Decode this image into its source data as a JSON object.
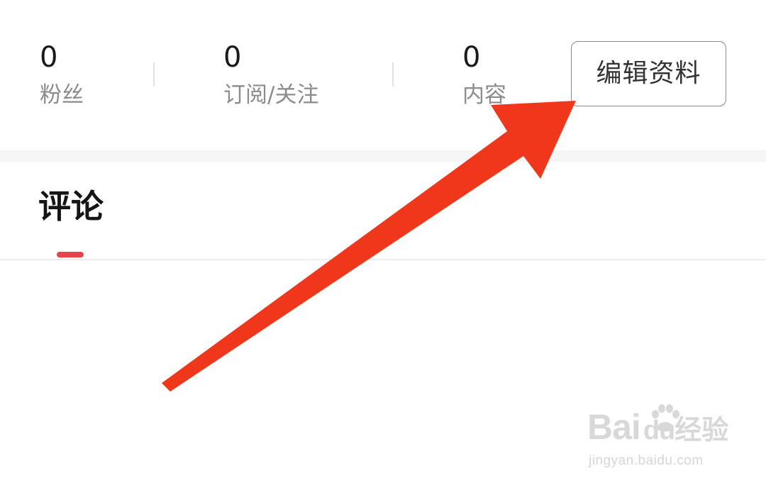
{
  "stats": [
    {
      "count": "0",
      "label": "粉丝"
    },
    {
      "count": "0",
      "label": "订阅/关注"
    },
    {
      "count": "0",
      "label": "内容"
    }
  ],
  "edit_button": {
    "label": "编辑资料"
  },
  "tabs": [
    {
      "label": "评论",
      "active": true
    }
  ],
  "colors": {
    "accent": "#e8434a",
    "annotation_arrow": "#f0371c",
    "band": "#f5f5f5"
  },
  "watermark": {
    "brand": "Baidu经验",
    "url": "jingyan.baidu.com"
  }
}
